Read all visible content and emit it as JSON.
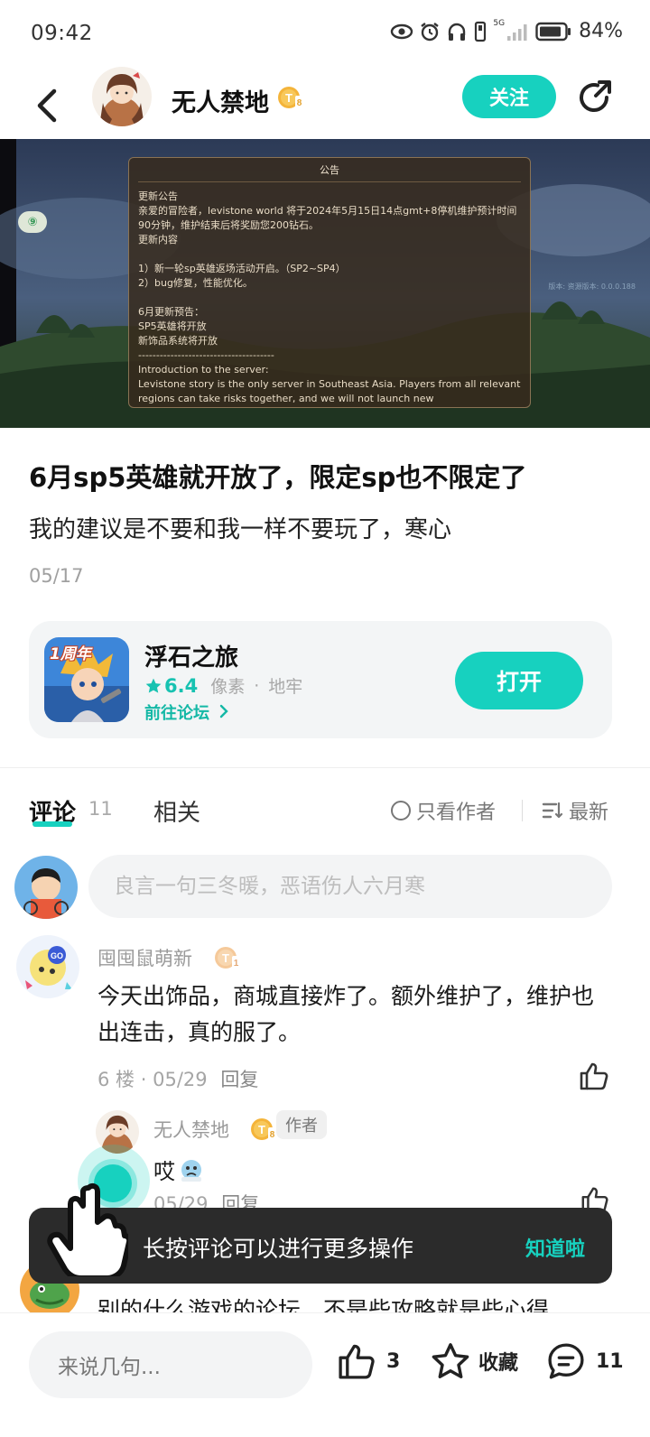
{
  "status_bar": {
    "time": "09:42",
    "battery": "84%",
    "network": "5G",
    "icons": [
      "eye-icon",
      "alarm-icon",
      "headphones-icon",
      "vibrate-icon",
      "signal-icon",
      "battery-icon"
    ]
  },
  "header": {
    "author_name": "无人禁地",
    "follow_label": "关注",
    "icons": [
      "back-arrow-icon",
      "share-icon",
      "level-badge-icon"
    ]
  },
  "banner": {
    "notice_title": "公告",
    "notice_body": "更新公告\n亲爱的冒险者，levistone world 将于2024年5月15日14点gmt+8停机维护预计时间90分钟，维护结束后将奖励您200钻石。\n更新内容\n\n1）新一轮sp英雄返场活动开启。（SP2~SP4）\n2）bug修复，性能优化。\n\n6月更新预告：\nSP5英雄将开放\n新饰品系统将开放\n--------------------------------------\nIntroduction to the server:\nLevistone story is the only server in Southeast Asia. Players from all relevant regions can take risks together, and we will not launch new",
    "version": "版本: 资源版本: 0.0.0.188",
    "side_badge": "⑨"
  },
  "post": {
    "title": "6月sp5英雄就开放了，限定sp也不限定了",
    "body": "我的建议是不要和我一样不要玩了，寒心",
    "date": "05/17"
  },
  "game_card": {
    "icon_text": "1周年",
    "name": "浮石之旅",
    "rating": "6.4",
    "tag1": "像素",
    "separator": "·",
    "tag2": "地牢",
    "forum_link": "前往论坛",
    "open_label": "打开",
    "accent_color": "#17d1bf"
  },
  "tabs": {
    "comments_label": "评论",
    "comments_count": "11",
    "related_label": "相关",
    "only_author_label": "只看作者",
    "sort_label": "最新"
  },
  "comment_input": {
    "placeholder": "良言一句三冬暖，恶语伤人六月寒"
  },
  "comments": [
    {
      "user": "囤囤鼠萌新",
      "text": "今天出饰品，商城直接炸了。额外维护了，维护也出连击，真的服了。",
      "floor": "6 楼",
      "separator": "·",
      "date": "05/29",
      "reply_label": "回复"
    }
  ],
  "reply": {
    "user": "无人禁地",
    "author_tag": "作者",
    "text": "哎",
    "date": "05/29",
    "reply_label": "回复"
  },
  "next_comment": {
    "text": "别的什么游戏的论坛，不是些攻略就是些心得"
  },
  "toast": {
    "text": "长按评论可以进行更多操作",
    "action": "知道啦"
  },
  "bottom_bar": {
    "input_placeholder": "来说几句...",
    "like_count": "3",
    "favorite_label": "收藏",
    "comment_count": "11"
  }
}
